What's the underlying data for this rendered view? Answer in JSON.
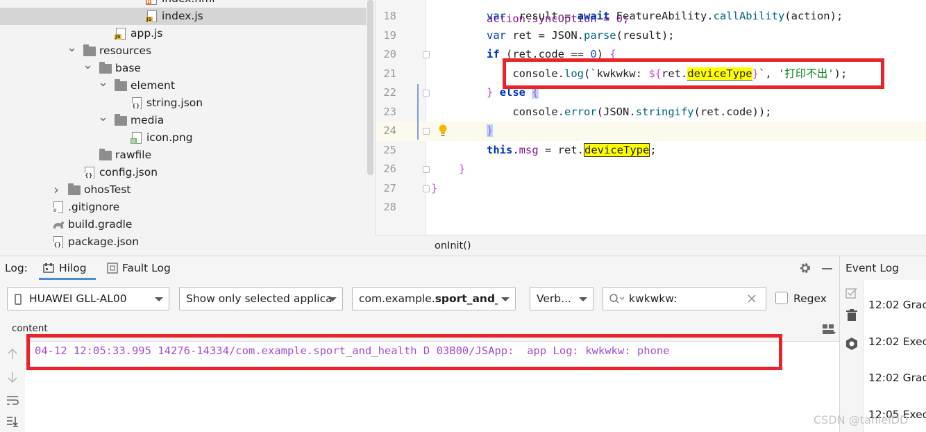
{
  "project_tree": {
    "items": [
      {
        "label": "index.hml",
        "icon": "hml-file-icon"
      },
      {
        "label": "index.js",
        "icon": "js-file-icon",
        "selected": true
      },
      {
        "label": "app.js",
        "icon": "js-file-icon"
      },
      {
        "label": "resources",
        "icon": "folder-icon",
        "expanded": true
      },
      {
        "label": "base",
        "icon": "folder-icon",
        "expanded": true
      },
      {
        "label": "element",
        "icon": "folder-icon",
        "expanded": true
      },
      {
        "label": "string.json",
        "icon": "json-file-icon"
      },
      {
        "label": "media",
        "icon": "folder-icon",
        "expanded": true
      },
      {
        "label": "icon.png",
        "icon": "image-file-icon"
      },
      {
        "label": "rawfile",
        "icon": "folder-icon"
      },
      {
        "label": "config.json",
        "icon": "json-file-icon"
      },
      {
        "label": "ohosTest",
        "icon": "folder-icon",
        "expanded": false
      },
      {
        "label": ".gitignore",
        "icon": "gitignore-file-icon"
      },
      {
        "label": "build.gradle",
        "icon": "gradle-file-icon"
      },
      {
        "label": "package.json",
        "icon": "json-file-icon"
      }
    ]
  },
  "editor": {
    "lines": [
      {
        "num": "18",
        "tokens": [
          [
            "kw2",
            "var"
          ],
          [
            "",
            "  result = "
          ],
          [
            "kw",
            "await"
          ],
          [
            "",
            " FeatureAbility."
          ],
          [
            "fn",
            "callAbility"
          ],
          [
            "",
            "(action);"
          ]
        ]
      },
      {
        "num": "19",
        "tokens": [
          [
            "kw2",
            "var"
          ],
          [
            "",
            " ret = JSON."
          ],
          [
            "fn",
            "parse"
          ],
          [
            "",
            "(result);"
          ]
        ]
      },
      {
        "num": "20",
        "tokens": [
          [
            "kw",
            "if"
          ],
          [
            "",
            " (ret.code == "
          ],
          [
            "num",
            "0"
          ],
          [
            "",
            ") "
          ],
          [
            "brace",
            "{"
          ]
        ]
      },
      {
        "num": "21",
        "tokens": [
          [
            "",
            "    console."
          ],
          [
            "fn",
            "log"
          ],
          [
            "",
            "(`kwkwkw: "
          ],
          [
            "brace",
            "${"
          ],
          [
            "",
            "ret."
          ],
          [
            "hl",
            "deviceType"
          ],
          [
            "brace",
            "}"
          ],
          [
            "",
            "`, "
          ],
          [
            "str",
            "'打印不出'"
          ],
          [
            "",
            ");"
          ]
        ]
      },
      {
        "num": "22",
        "tokens": [
          [
            "brace",
            "}"
          ],
          [
            "",
            " "
          ],
          [
            "kw",
            "else"
          ],
          [
            "",
            " "
          ],
          [
            "blue",
            "{"
          ]
        ]
      },
      {
        "num": "23",
        "tokens": [
          [
            "",
            "    console."
          ],
          [
            "fn",
            "error"
          ],
          [
            "",
            "(JSON."
          ],
          [
            "fn",
            "stringify"
          ],
          [
            "",
            "(ret.code));"
          ]
        ]
      },
      {
        "num": "24",
        "tokens": [
          [
            "blue",
            "}"
          ]
        ]
      },
      {
        "num": "25",
        "tokens": [
          [
            "kw",
            "this"
          ],
          [
            "",
            "."
          ],
          [
            "prop",
            "msg"
          ],
          [
            "",
            " = ret."
          ],
          [
            "hl2",
            "deviceType"
          ],
          [
            "",
            ";"
          ]
        ]
      },
      {
        "num": "26",
        "tokens": [
          [
            "brace",
            "}"
          ]
        ]
      },
      {
        "num": "27",
        "tokens": [
          [
            "brace",
            "}"
          ]
        ]
      },
      {
        "num": "28",
        "tokens": []
      }
    ],
    "partial_top_line": "action.syncOption = 0;",
    "breadcrumb": "onInit()"
  },
  "log_panel": {
    "label": "Log:",
    "tabs": [
      {
        "label": "Hilog",
        "icon": "hilog-icon",
        "active": true
      },
      {
        "label": "Fault Log",
        "icon": "fault-log-icon",
        "active": false
      }
    ],
    "device_select": "HUAWEI GLL-AL00",
    "filter_select": "Show only selected applica",
    "package_select_prefix": "com.example.",
    "package_select_bold": "sport_and_he",
    "level_select": "Verb...",
    "search_value": "kwkwkw:",
    "regex_label": "Regex",
    "content_label": "content",
    "log_line": "04-12 12:05:33.995 14276-14334/com.example.sport_and_health D 03B00/JSApp:  app Log: kwkwkw: phone"
  },
  "event_log": {
    "title": "Event Log",
    "rows": [
      {
        "time": "12:02",
        "text": "Grad"
      },
      {
        "time": "12:02",
        "text": "Execu"
      },
      {
        "time": "12:02",
        "text": "Grad"
      },
      {
        "time": "12:05",
        "text": "Execu"
      }
    ]
  },
  "watermark": "CSDN @tanleiDD",
  "colors": {
    "highlight_box": "#e8242a",
    "log_text": "#a24bd2",
    "search_highlight": "#ffff00"
  }
}
